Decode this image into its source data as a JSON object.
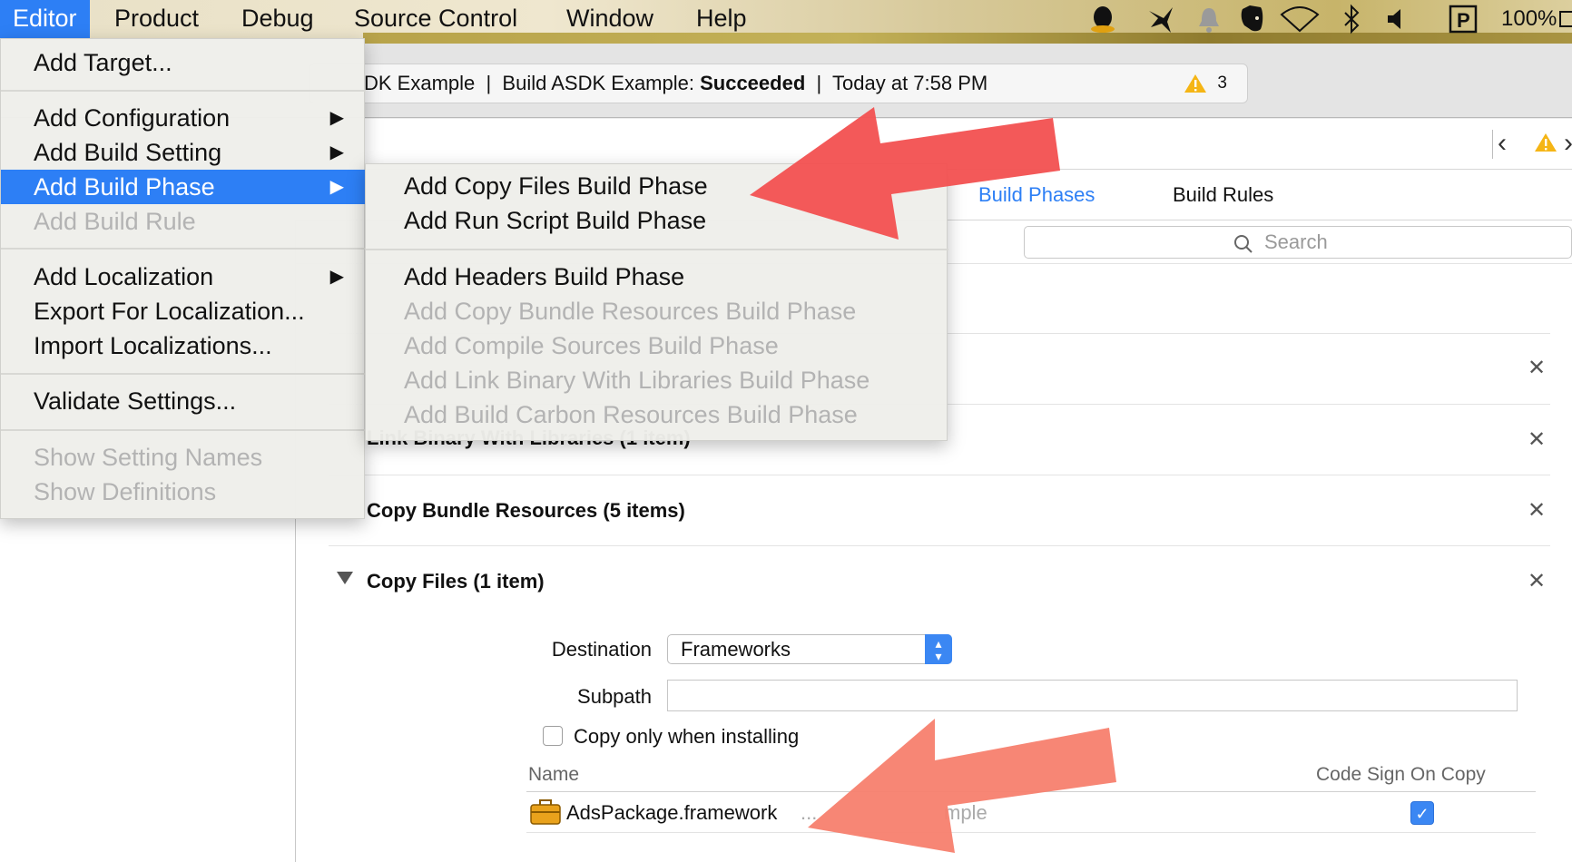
{
  "menubar": {
    "items": [
      "Editor",
      "Product",
      "Debug",
      "Source Control",
      "Window",
      "Help"
    ],
    "battery": "100%"
  },
  "toolbar": {
    "status_prefix": "DK Example  |  Build ASDK Example: ",
    "status_result": "Succeeded",
    "status_suffix": "  |  Today at 7:58 PM",
    "warning_count": "3"
  },
  "tabs": {
    "build_phases": "Build Phases",
    "build_rules": "Build Rules"
  },
  "search": {
    "placeholder": "Search"
  },
  "sections": {
    "link_binary": "Link Binary With Libraries (1 item)",
    "copy_bundle": "Copy Bundle Resources (5 items)",
    "copy_files": "Copy Files (1 item)"
  },
  "copy_files": {
    "destination_label": "Destination",
    "destination_value": "Frameworks",
    "subpath_label": "Subpath",
    "copy_only_label": "Copy only when installing",
    "col_name": "Name",
    "col_codesign": "Code Sign On Copy",
    "row_name": "AdsPackage.framework",
    "row_path": "...",
    "row_path_tail": "mple"
  },
  "editor_menu": {
    "items": [
      {
        "label": "Add Target...",
        "disabled": false
      },
      {
        "label": "Add Configuration",
        "disabled": false,
        "submenu": true
      },
      {
        "label": "Add Build Setting",
        "disabled": false,
        "submenu": true
      },
      {
        "label": "Add Build Phase",
        "disabled": false,
        "submenu": true,
        "highlighted": true
      },
      {
        "label": "Add Build Rule",
        "disabled": true
      },
      {
        "label": "Add Localization",
        "disabled": false,
        "submenu": true
      },
      {
        "label": "Export For Localization...",
        "disabled": false
      },
      {
        "label": "Import Localizations...",
        "disabled": false
      },
      {
        "label": "Validate Settings...",
        "disabled": false
      },
      {
        "label": "Show Setting Names",
        "disabled": true
      },
      {
        "label": "Show Definitions",
        "disabled": true
      }
    ]
  },
  "build_phase_submenu": {
    "items": [
      {
        "label": "Add Copy Files Build Phase",
        "disabled": false
      },
      {
        "label": "Add Run Script Build Phase",
        "disabled": false
      },
      {
        "label": "Add Headers Build Phase",
        "disabled": false
      },
      {
        "label": "Add Copy Bundle Resources Build Phase",
        "disabled": true
      },
      {
        "label": "Add Compile Sources Build Phase",
        "disabled": true
      },
      {
        "label": "Add Link Binary With Libraries Build Phase",
        "disabled": true
      },
      {
        "label": "Add Build Carbon Resources Build Phase",
        "disabled": true
      }
    ]
  },
  "colors": {
    "accent": "#2d7ff5",
    "annotation_arrow": "#f35252",
    "annotation_arrow_2": "#f7806e"
  }
}
